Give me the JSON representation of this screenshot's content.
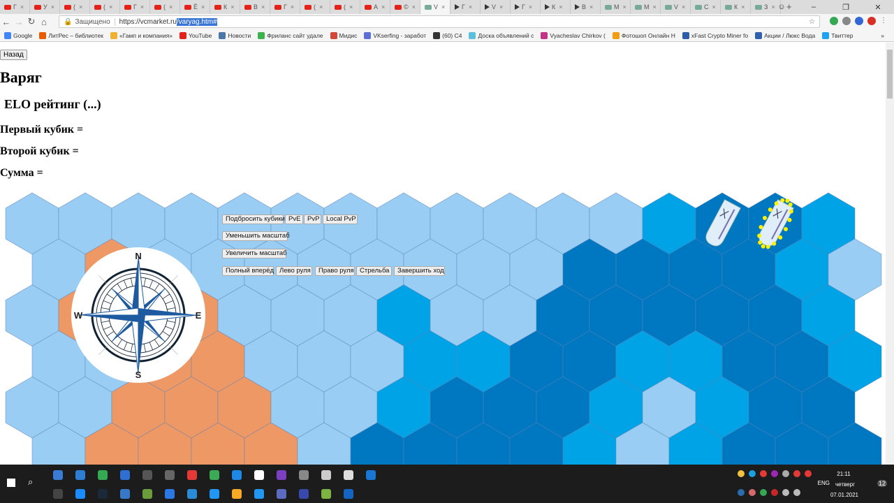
{
  "browser": {
    "tabs": [
      {
        "icon": "youtube",
        "label": "Г"
      },
      {
        "icon": "youtube",
        "label": "У"
      },
      {
        "icon": "youtube",
        "label": "("
      },
      {
        "icon": "youtube",
        "label": "("
      },
      {
        "icon": "youtube",
        "label": "Г"
      },
      {
        "icon": "youtube",
        "label": "("
      },
      {
        "icon": "youtube",
        "label": "Ё"
      },
      {
        "icon": "youtube",
        "label": "К"
      },
      {
        "icon": "youtube",
        "label": "В"
      },
      {
        "icon": "youtube",
        "label": "Г"
      },
      {
        "icon": "youtube",
        "label": "("
      },
      {
        "icon": "youtube",
        "label": "("
      },
      {
        "icon": "youtube",
        "label": "А"
      },
      {
        "icon": "youtube",
        "label": "©"
      },
      {
        "icon": "vc",
        "label": "V",
        "active": true
      },
      {
        "icon": "play",
        "label": "Г"
      },
      {
        "icon": "play",
        "label": "V"
      },
      {
        "icon": "play",
        "label": "Г"
      },
      {
        "icon": "play",
        "label": "К"
      },
      {
        "icon": "play",
        "label": "В"
      },
      {
        "icon": "other",
        "label": "М"
      },
      {
        "icon": "other",
        "label": "М"
      },
      {
        "icon": "github",
        "label": "V"
      },
      {
        "icon": "other",
        "label": "С"
      },
      {
        "icon": "other",
        "label": "К"
      },
      {
        "icon": "other",
        "label": "З"
      }
    ],
    "new_tab": "+",
    "security_label": "Защищено",
    "url_base": "https://vcmarket.ru",
    "url_selected": "/varyag.htm#",
    "bookmarks": [
      {
        "label": "Google",
        "color": "#4285f4"
      },
      {
        "label": "ЛитРес – библиотек",
        "color": "#e65c00"
      },
      {
        "label": "«Гамп и компания»",
        "color": "#f0b030"
      },
      {
        "label": "YouTube",
        "color": "#e62117"
      },
      {
        "label": "Новости",
        "color": "#4a76a8"
      },
      {
        "label": "Фриланс сайт удале",
        "color": "#3bb34a"
      },
      {
        "label": "Мидис",
        "color": "#d44638"
      },
      {
        "label": "VKserfing - заработ",
        "color": "#5b6fd6"
      },
      {
        "label": "(60) C4",
        "color": "#333333"
      },
      {
        "label": "Доска объявлений с",
        "color": "#5bc0de"
      },
      {
        "label": "Vyacheslav Chirkov (",
        "color": "#c13584"
      },
      {
        "label": "Фотошоп Онлайн Н",
        "color": "#f39c12"
      },
      {
        "label": "xFast Crypto Miner fo",
        "color": "#2a5caa"
      },
      {
        "label": "Акции / Люкс Вода",
        "color": "#3060b0"
      },
      {
        "label": "Твиттер",
        "color": "#1da1f2"
      }
    ],
    "more": "»"
  },
  "page": {
    "back": "Назад",
    "title": "Варяг",
    "elo": "ELO рейтинг (...)",
    "dice1": "Первый кубик =",
    "dice2": "Второй кубик =",
    "sum": "Сумма =",
    "buttons": {
      "roll": "Подбросить кубики",
      "pve": "PvE",
      "pvp": "PvP",
      "local_pvp": "Local PvP",
      "zoom_out": "Уменьшить масштаб",
      "zoom_in": "Увеличить масштаб",
      "full_ahead": "Полный вперёд",
      "left_rudder": "Лево руля",
      "right_rudder": "Право руля",
      "fire": "Стрельба",
      "end_turn": "Завершить ход"
    },
    "compass": {
      "n": "N",
      "s": "S",
      "e": "E",
      "w": "W"
    }
  },
  "map": {
    "colors": {
      "L": "#99cdf3",
      "M": "#00a3e6",
      "D": "#0077c1",
      "O": "#ee9865"
    },
    "rows": [
      "LLLLLLLLLLLLMDDM",
      "LOLLLLLLLLDDDDML",
      "LOOOLLLMLLDDDDDM",
      "LLOOLLLMMDDMMDDM",
      "LLOOOLLMDDDMLMDD",
      "LOOOOLDDDDMLMDDD"
    ],
    "ships": [
      {
        "row": 0,
        "col": 13,
        "selected": false
      },
      {
        "row": 0,
        "col": 14,
        "selected": true
      }
    ]
  },
  "taskbar": {
    "lang": "ENG",
    "time": "21:11",
    "day": "четверг",
    "date": "07.01.2021",
    "notifications": "12"
  }
}
